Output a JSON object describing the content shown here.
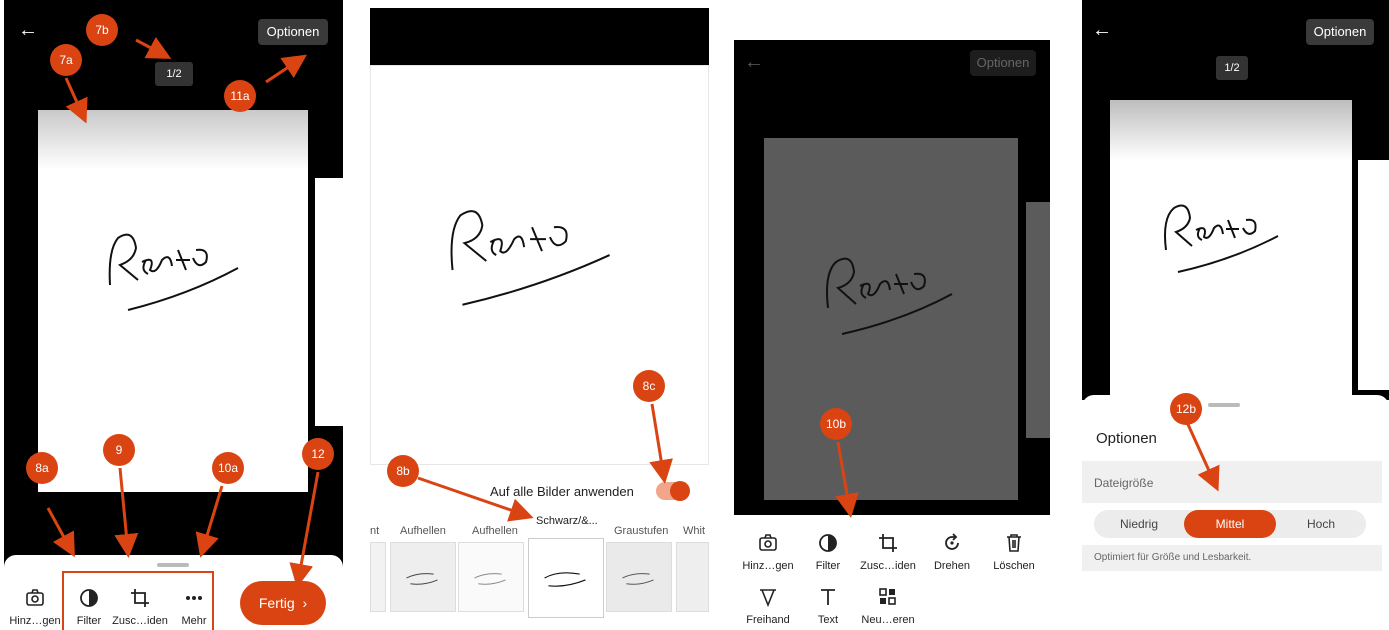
{
  "colors": {
    "accent": "#d94412",
    "bar_bg": "#3a3a3a",
    "page_bg": "#000000"
  },
  "panel1": {
    "options_label": "Optionen",
    "page_indicator": "1/2",
    "handwriting": "Recto",
    "badges": {
      "b7a": "7a",
      "b7b": "7b",
      "b11a": "11a",
      "b8a": "8a",
      "b9": "9",
      "b10a": "10a",
      "b12": "12"
    },
    "toolbar": {
      "add_label": "Hinz…gen",
      "filter_label": "Filter",
      "crop_label": "Zusc…iden",
      "more_label": "Mehr",
      "done_label": "Fertig"
    }
  },
  "panel2": {
    "handwriting": "Recto",
    "apply_all_label": "Auf alle Bilder anwenden",
    "apply_all_on": true,
    "badges": {
      "b8b": "8b",
      "b8c": "8c"
    },
    "filters": [
      {
        "label": "nt"
      },
      {
        "label": "Aufhellen"
      },
      {
        "label": "Aufhellen"
      },
      {
        "label": "Schwarz/&..."
      },
      {
        "label": "Graustufen"
      },
      {
        "label": "Whit"
      }
    ],
    "selected_filter_index": 3
  },
  "panel3": {
    "options_label": "Optionen",
    "handwriting": "Recto",
    "badges": {
      "b10b": "10b"
    },
    "tools_row1": [
      {
        "label": "Hinz…gen",
        "icon": "camera-add-icon"
      },
      {
        "label": "Filter",
        "icon": "filter-icon"
      },
      {
        "label": "Zusc…iden",
        "icon": "crop-icon"
      },
      {
        "label": "Drehen",
        "icon": "rotate-icon"
      },
      {
        "label": "Löschen",
        "icon": "trash-icon"
      }
    ],
    "tools_row2": [
      {
        "label": "Freihand",
        "icon": "freehand-icon"
      },
      {
        "label": "Text",
        "icon": "text-icon"
      },
      {
        "label": "Neu…eren",
        "icon": "reorder-icon"
      }
    ]
  },
  "panel4": {
    "options_label": "Optionen",
    "page_indicator": "1/2",
    "handwriting": "Recto",
    "badges": {
      "b12b": "12b"
    },
    "sheet": {
      "title": "Optionen",
      "section_label": "Dateigröße",
      "options": [
        "Niedrig",
        "Mittel",
        "Hoch"
      ],
      "selected_index": 1,
      "hint": "Optimiert für Größe und Lesbarkeit."
    }
  }
}
